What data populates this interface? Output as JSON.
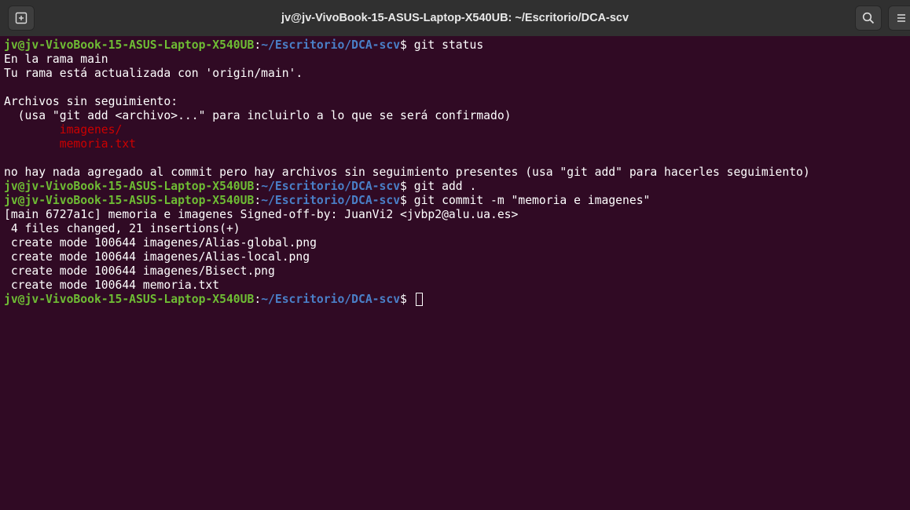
{
  "window": {
    "title": "jv@jv-VivoBook-15-ASUS-Laptop-X540UB: ~/Escritorio/DCA-scv",
    "new_tab_icon": "new-tab-icon",
    "search_icon": "search-icon",
    "menu_icon": "hamburger-menu-icon"
  },
  "prompt": {
    "user_host": "jv@jv-VivoBook-15-ASUS-Laptop-X540UB",
    "separator": ":",
    "path": "~/Escritorio/DCA-scv",
    "symbol": "$ "
  },
  "colors": {
    "background": "#300a24",
    "prompt_user": "#6ebc34",
    "prompt_path": "#4a7fc7",
    "untracked": "#cc0000",
    "text": "#ffffff"
  },
  "lines": [
    {
      "type": "prompt",
      "command": "git status"
    },
    {
      "type": "text",
      "text": "En la rama main"
    },
    {
      "type": "text",
      "text": "Tu rama está actualizada con 'origin/main'."
    },
    {
      "type": "text",
      "text": ""
    },
    {
      "type": "text",
      "text": "Archivos sin seguimiento:"
    },
    {
      "type": "text",
      "text": "  (usa \"git add <archivo>...\" para incluirlo a lo que se será confirmado)"
    },
    {
      "type": "untracked",
      "text": "\timagenes/"
    },
    {
      "type": "untracked",
      "text": "\tmemoria.txt"
    },
    {
      "type": "text",
      "text": ""
    },
    {
      "type": "text",
      "text": "no hay nada agregado al commit pero hay archivos sin seguimiento presentes (usa \"git add\" para hacerles seguimiento)"
    },
    {
      "type": "prompt",
      "command": "git add ."
    },
    {
      "type": "prompt",
      "command": "git commit -m \"memoria e imagenes\""
    },
    {
      "type": "text",
      "text": "[main 6727a1c] memoria e imagenes Signed-off-by: JuanVi2 <jvbp2@alu.ua.es>"
    },
    {
      "type": "text",
      "text": " 4 files changed, 21 insertions(+)"
    },
    {
      "type": "text",
      "text": " create mode 100644 imagenes/Alias-global.png"
    },
    {
      "type": "text",
      "text": " create mode 100644 imagenes/Alias-local.png"
    },
    {
      "type": "text",
      "text": " create mode 100644 imagenes/Bisect.png"
    },
    {
      "type": "text",
      "text": " create mode 100644 memoria.txt"
    },
    {
      "type": "prompt",
      "command": "",
      "cursor": true
    }
  ]
}
